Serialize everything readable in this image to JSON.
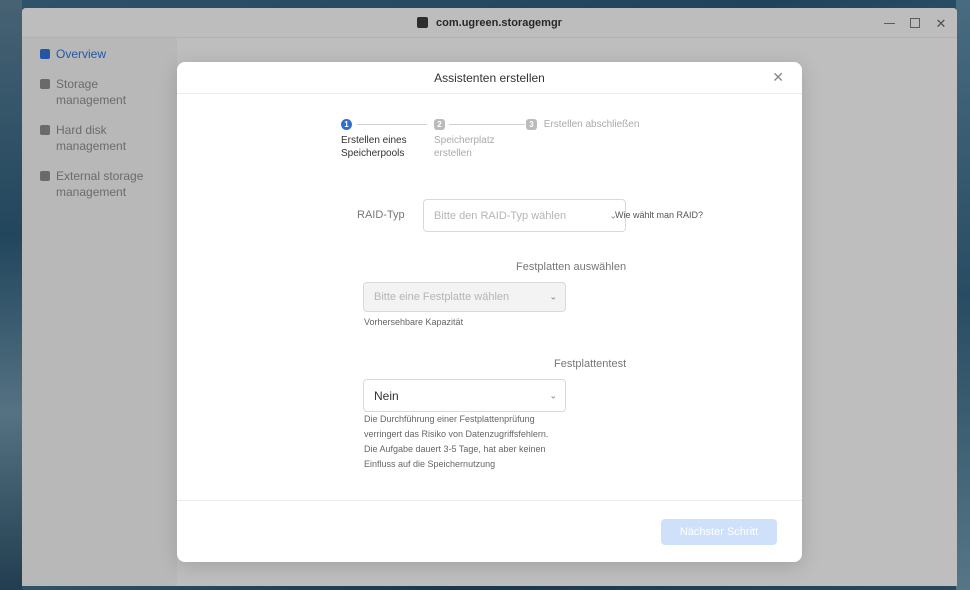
{
  "window": {
    "title": "com.ugreen.storagemgr"
  },
  "sidebar": {
    "items": [
      {
        "label": "Overview",
        "icon": "overview-icon",
        "active": true
      },
      {
        "label": "Storage management",
        "icon": "database-icon",
        "active": false
      },
      {
        "label": "Hard disk management",
        "icon": "hard-disk-icon",
        "active": false
      },
      {
        "label": "External storage management",
        "icon": "external-drive-icon",
        "active": false
      }
    ]
  },
  "modal": {
    "title": "Assistenten erstellen",
    "steps": [
      {
        "number": "1",
        "label": "Erstellen eines Speicherpools",
        "active": true
      },
      {
        "number": "2",
        "label": "Speicherplatz erstellen",
        "active": false
      },
      {
        "number": "3",
        "label": "Erstellen abschließen",
        "active": false
      }
    ],
    "raid": {
      "label": "RAID-Typ",
      "placeholder": "Bitte den RAID-Typ wählen",
      "help": "Wie wählt man RAID?"
    },
    "disks": {
      "label": "Festplatten auswählen",
      "placeholder": "Bitte eine Festplatte wählen",
      "capacity_label": "Vorhersehbare Kapazität"
    },
    "disktest": {
      "label": "Festplattentest",
      "value": "Nein",
      "hint_lines": [
        "Die Durchführung einer Festplattenprüfung",
        "verringert das Risiko von Datenzugriffsfehlern.",
        "Die Aufgabe dauert 3-5 Tage, hat aber keinen",
        "Einfluss auf die Speichernutzung"
      ]
    },
    "next_button": "Nächster Schritt"
  },
  "colors": {
    "accent": "#2f6fd1",
    "button_disabled": "#cfe0fb"
  }
}
